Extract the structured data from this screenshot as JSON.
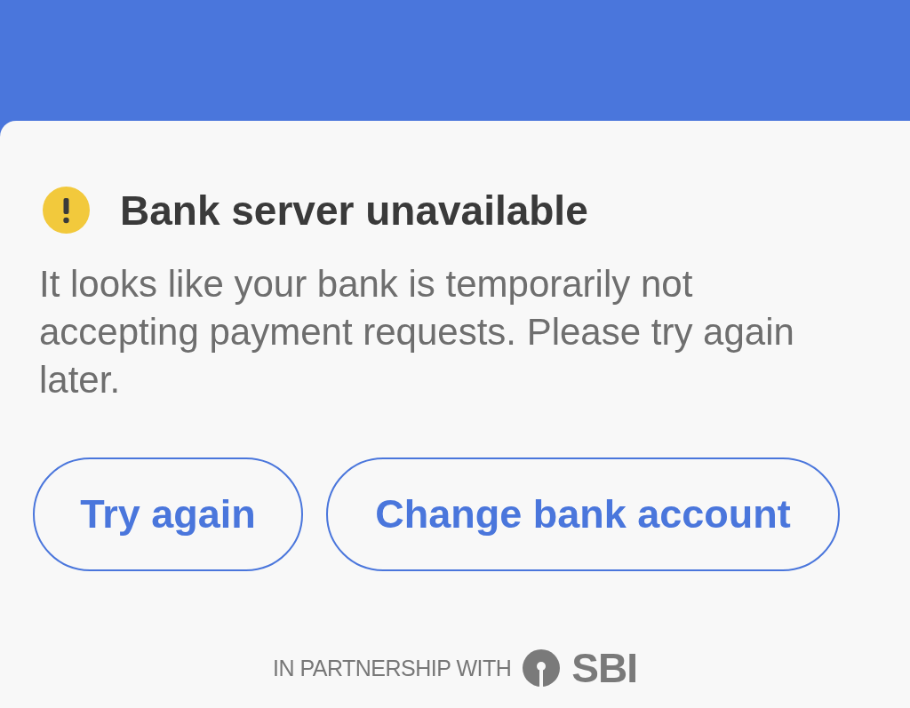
{
  "dialog": {
    "title": "Bank server unavailable",
    "message": "It looks like your bank is temporarily not accepting payment requests. Please try again later.",
    "buttons": [
      "Try again",
      "Change bank account"
    ],
    "footer": {
      "text": "IN PARTNERSHIP WITH",
      "logo_text": "SBI"
    }
  }
}
